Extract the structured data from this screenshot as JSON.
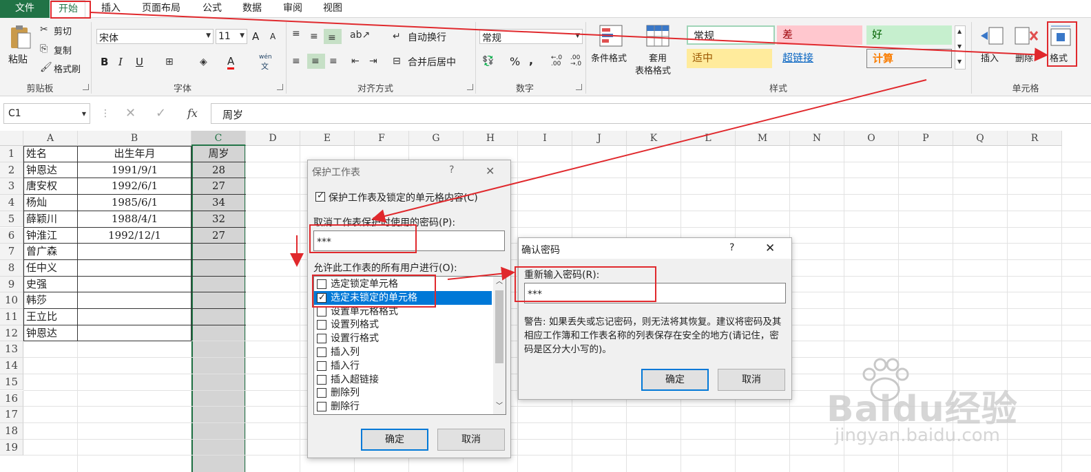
{
  "menu": {
    "file": "文件",
    "tabs": [
      "开始",
      "插入",
      "页面布局",
      "公式",
      "数据",
      "审阅",
      "视图"
    ]
  },
  "clipboard": {
    "paste": "粘贴",
    "cut": "剪切",
    "copy": "复制",
    "format_painter": "格式刷",
    "label": "剪贴板"
  },
  "font": {
    "name": "宋体",
    "size": "11",
    "bold": "B",
    "italic": "I",
    "underline": "U",
    "grow": "A",
    "shrink": "A",
    "color_a": "A",
    "wen": "wén",
    "wen2": "文",
    "label": "字体"
  },
  "alignment": {
    "wrap": "自动换行",
    "merge": "合并后居中",
    "label": "对齐方式"
  },
  "number": {
    "format": "常规",
    "percent": "%",
    "comma": ",",
    "inc": "←.0 .00",
    "dec": ".00 →.0",
    "label": "数字"
  },
  "styles": {
    "conditional": "条件格式",
    "table_format_1": "套用",
    "table_format_2": "表格格式",
    "normal": "常规",
    "bad": "差",
    "good": "好",
    "neutral": "适中",
    "hyperlink": "超链接",
    "calc": "计算",
    "label": "样式"
  },
  "cells": {
    "insert": "插入",
    "delete": "删除",
    "format": "格式",
    "label": "单元格"
  },
  "formula": {
    "name_box": "C1",
    "fx": "fx",
    "value": "周岁"
  },
  "columns": [
    "A",
    "B",
    "C",
    "D",
    "E",
    "F",
    "G",
    "H",
    "I",
    "J",
    "K",
    "L",
    "M",
    "N",
    "O",
    "P",
    "Q",
    "R"
  ],
  "rows": [
    "1",
    "2",
    "3",
    "4",
    "5",
    "6",
    "7",
    "8",
    "9",
    "10",
    "11",
    "12",
    "13",
    "14",
    "15",
    "16",
    "17",
    "18",
    "19"
  ],
  "table": {
    "headers": [
      "姓名",
      "出生年月",
      "周岁"
    ],
    "rows": [
      [
        "钟恩达",
        "1991/9/1",
        "28"
      ],
      [
        "唐安权",
        "1992/6/1",
        "27"
      ],
      [
        "杨灿",
        "1985/6/1",
        "34"
      ],
      [
        "薛颖川",
        "1988/4/1",
        "32"
      ],
      [
        "钟淮江",
        "1992/12/1",
        "27"
      ],
      [
        "曾广森",
        "",
        ""
      ],
      [
        "任中义",
        "",
        ""
      ],
      [
        "史强",
        "",
        ""
      ],
      [
        "韩莎",
        "",
        ""
      ],
      [
        "王立比",
        "",
        ""
      ],
      [
        "钟恩达",
        "",
        ""
      ]
    ]
  },
  "protect": {
    "title": "保护工作表",
    "help": "?",
    "close": "✕",
    "protect_check": "保护工作表及锁定的单元格内容(C)",
    "pwd_label": "取消工作表保护时使用的密码(P):",
    "pwd_value": "***",
    "allow_label": "允许此工作表的所有用户进行(O):",
    "options": [
      {
        "label": "选定锁定单元格",
        "checked": false
      },
      {
        "label": "选定未锁定的单元格",
        "checked": true
      },
      {
        "label": "设置单元格格式",
        "checked": false
      },
      {
        "label": "设置列格式",
        "checked": false
      },
      {
        "label": "设置行格式",
        "checked": false
      },
      {
        "label": "插入列",
        "checked": false
      },
      {
        "label": "插入行",
        "checked": false
      },
      {
        "label": "插入超链接",
        "checked": false
      },
      {
        "label": "删除列",
        "checked": false
      },
      {
        "label": "删除行",
        "checked": false
      }
    ],
    "ok": "确定",
    "cancel": "取消"
  },
  "confirm": {
    "title": "确认密码",
    "help": "?",
    "close": "✕",
    "label": "重新输入密码(R):",
    "value": "***",
    "warning": "警告: 如果丢失或忘记密码，则无法将其恢复。建议将密码及其相应工作簿和工作表名称的列表保存在安全的地方(请记住，密码是区分大小写的)。",
    "ok": "确定",
    "cancel": "取消"
  },
  "watermark": {
    "brand": "Baidu经验",
    "url": "jingyan.baidu.com"
  },
  "colors": {
    "excel_green": "#217346",
    "annotation_red": "#e0282c",
    "selection_blue": "#0078d7",
    "column_c_fill": "#d4d4d4"
  }
}
